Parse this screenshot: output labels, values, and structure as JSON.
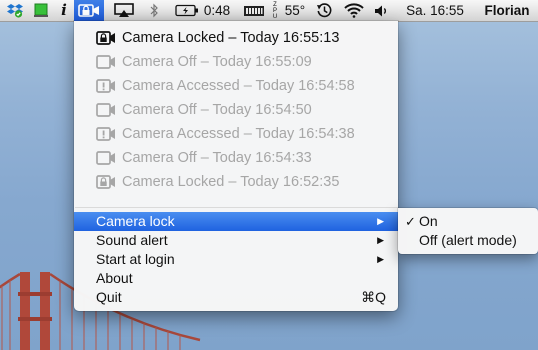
{
  "menubar": {
    "battery_time": "0:48",
    "temperature": "55°",
    "clock": "Sa. 16:55",
    "user": "Florian",
    "icons": [
      "dropbox-icon",
      "green-app-icon",
      "info-icon",
      "camera-lock-icon",
      "airplay-icon",
      "bluetooth-icon",
      "battery-icon",
      "memory-chip-icon",
      "cpu-temp-icon",
      "time-machine-icon",
      "wifi-icon",
      "volume-icon"
    ]
  },
  "menu": {
    "history": [
      {
        "icon": "camera-locked-icon",
        "text": "Camera Locked – Today 16:55:13",
        "enabled": true
      },
      {
        "icon": "camera-off-icon",
        "text": "Camera Off – Today 16:55:09",
        "enabled": false
      },
      {
        "icon": "camera-accessed-icon",
        "text": "Camera Accessed – Today 16:54:58",
        "enabled": false
      },
      {
        "icon": "camera-off-icon",
        "text": "Camera Off – Today 16:54:50",
        "enabled": false
      },
      {
        "icon": "camera-accessed-icon",
        "text": "Camera Accessed – Today 16:54:38",
        "enabled": false
      },
      {
        "icon": "camera-off-icon",
        "text": "Camera Off – Today 16:54:33",
        "enabled": false
      },
      {
        "icon": "camera-locked-icon",
        "text": "Camera Locked – Today 16:52:35",
        "enabled": false
      }
    ],
    "items": {
      "camera_lock": "Camera lock",
      "sound_alert": "Sound alert",
      "start_at_login": "Start at login",
      "about": "About",
      "quit": "Quit",
      "quit_shortcut": "⌘Q"
    },
    "highlight_color": "#2a6de6"
  },
  "submenu": {
    "checkmark": "✓",
    "on": "On",
    "off": "Off (alert mode)"
  }
}
